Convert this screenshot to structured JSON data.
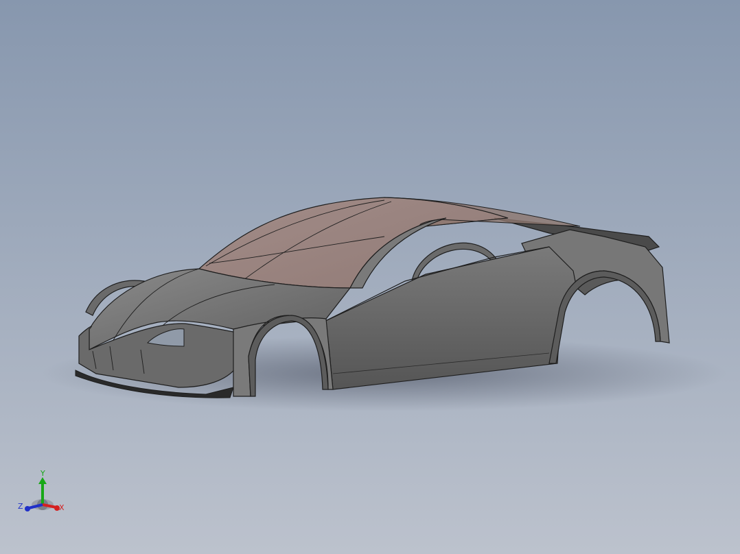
{
  "viewport": {
    "background_top": "#8797ae",
    "background_bottom": "#bcc2cd"
  },
  "model": {
    "body_color": "#6e6e6e",
    "body_light": "#8f8f8f",
    "body_dark": "#4e4e4e",
    "glass_color": "#9c7f74",
    "edge_color": "#1e1e1e"
  },
  "triad": {
    "x_label": "X",
    "y_label": "Y",
    "z_label": "Z",
    "x_color": "#d42020",
    "y_color": "#18a818",
    "z_color": "#2030c8"
  }
}
